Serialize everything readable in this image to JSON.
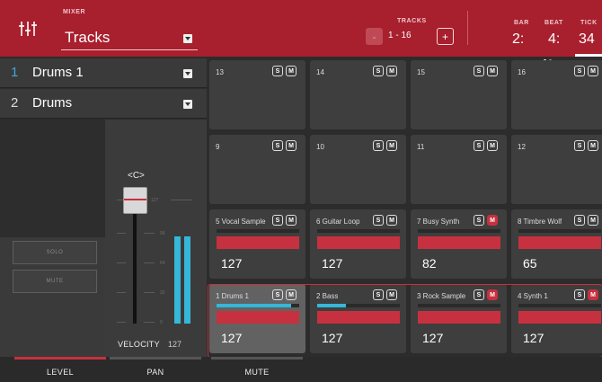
{
  "header": {
    "mixer_label": "MIXER",
    "mixer_value": "Tracks",
    "tracks_label": "TRACKS",
    "tracks_range": "1 - 16",
    "minus": "-",
    "plus": "+",
    "bar_label": "BAR",
    "beat_label": "BEAT",
    "tick_label": "TICK",
    "bar_value": "2:",
    "beat_value": "4:",
    "tick_value": "34"
  },
  "tracks": [
    {
      "num": "1",
      "name": "Drums 1"
    },
    {
      "num": "2",
      "name": "Drums"
    }
  ],
  "buttons": {
    "solo": "SOLO",
    "mute": "MUTE"
  },
  "fader": {
    "pan": "<C>",
    "velocity_label": "VELOCITY",
    "velocity_value": "127",
    "ticks": [
      "127",
      "96",
      "64",
      "32",
      "0"
    ]
  },
  "tabs": {
    "level": "LEVEL",
    "pan": "PAN",
    "mute": "MUTE"
  },
  "pads": [
    {
      "label": "13",
      "s": "S",
      "m": "M"
    },
    {
      "label": "14",
      "s": "S",
      "m": "M"
    },
    {
      "label": "15",
      "s": "S",
      "m": "M"
    },
    {
      "label": "16",
      "s": "S",
      "m": "M"
    },
    {
      "label": "9",
      "s": "S",
      "m": "M"
    },
    {
      "label": "10",
      "s": "S",
      "m": "M"
    },
    {
      "label": "11",
      "s": "S",
      "m": "M"
    },
    {
      "label": "12",
      "s": "S",
      "m": "M"
    },
    {
      "label": "5 Vocal Sample",
      "s": "S",
      "m": "M",
      "level": "127",
      "muted": false
    },
    {
      "label": "6 Guitar Loop",
      "s": "S",
      "m": "M",
      "level": "127",
      "muted": false
    },
    {
      "label": "7 Busy Synth",
      "s": "S",
      "m": "M",
      "level": "82",
      "muted": true
    },
    {
      "label": "8 Timbre Wolf",
      "s": "S",
      "m": "M",
      "level": "65",
      "muted": false
    },
    {
      "label": "1 Drums 1",
      "s": "S",
      "m": "M",
      "level": "127",
      "muted": false,
      "meter": 0.9
    },
    {
      "label": "2 Bass",
      "s": "S",
      "m": "M",
      "level": "127",
      "muted": false,
      "meter": 0.35
    },
    {
      "label": "3 Rock Sample",
      "s": "S",
      "m": "M",
      "level": "127",
      "muted": true
    },
    {
      "label": "4 Synth 1",
      "s": "S",
      "m": "M",
      "level": "127",
      "muted": true
    }
  ],
  "colors": {
    "accent": "#a81f2e",
    "meter": "#36b6d8",
    "level_bar": "#c7313f"
  }
}
